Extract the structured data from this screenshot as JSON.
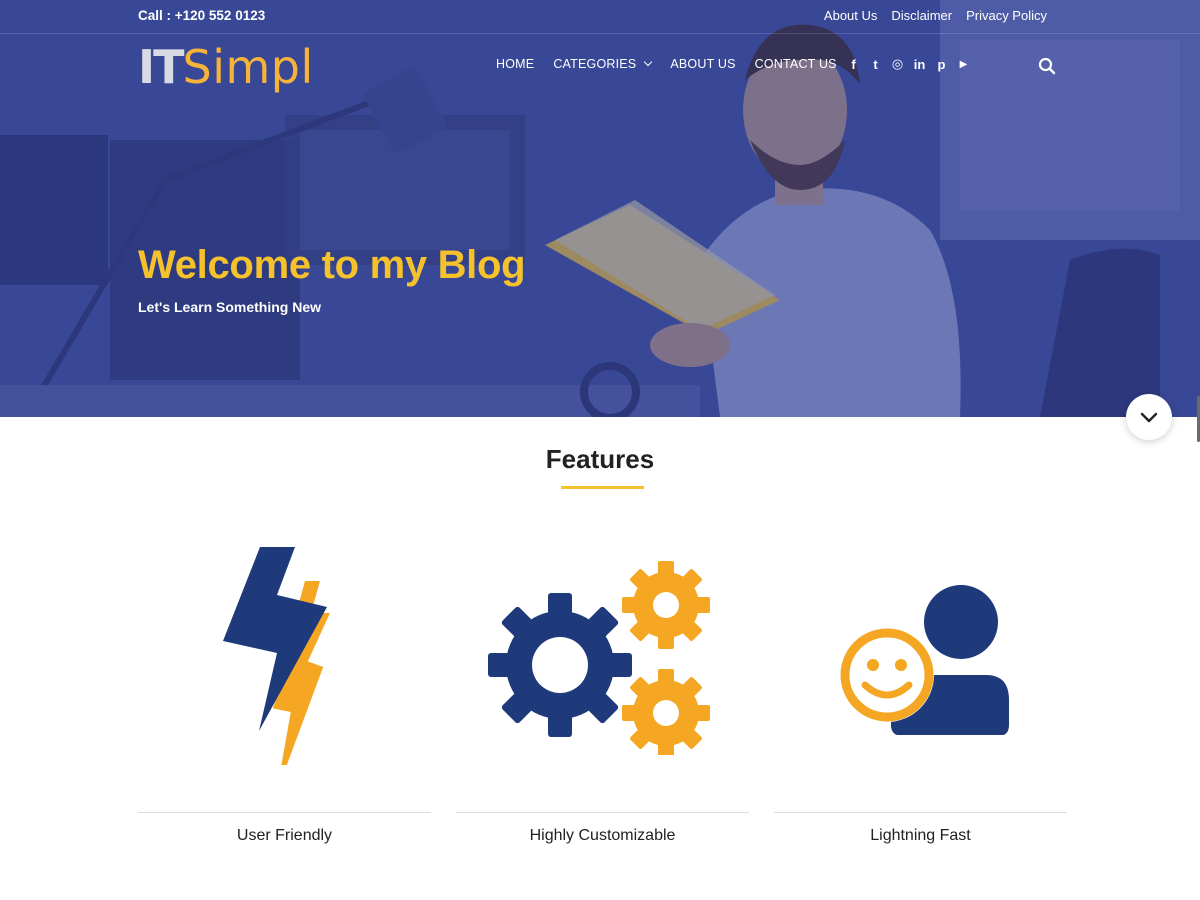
{
  "topbar": {
    "call": "Call : +120 552 0123",
    "links": [
      "About Us",
      "Disclaimer",
      "Privacy Policy"
    ]
  },
  "logo": {
    "part1": "IT",
    "part2": "Simpl"
  },
  "nav": {
    "items": [
      "HOME",
      "CATEGORIES",
      "ABOUT US",
      "CONTACT US"
    ]
  },
  "social": {
    "icons": [
      "facebook-icon",
      "twitter-icon",
      "instagram-icon",
      "linkedin-icon",
      "pinterest-icon",
      "youtube-icon"
    ],
    "glyphs": [
      "f",
      "t",
      "◎",
      "in",
      "p",
      "▶"
    ]
  },
  "hero": {
    "title": "Welcome to my Blog",
    "subtitle": "Let's Learn Something New"
  },
  "features": {
    "title": "Features",
    "items": [
      {
        "label": "User Friendly",
        "icon": "lightning-bolt-icon"
      },
      {
        "label": "Highly Customizable",
        "icon": "gears-icon"
      },
      {
        "label": "Lightning Fast",
        "icon": "smiley-user-icon"
      }
    ]
  },
  "colors": {
    "accent": "#f5c22c",
    "navy": "#1f3a7a",
    "hero_overlay": "#3b4b99"
  }
}
